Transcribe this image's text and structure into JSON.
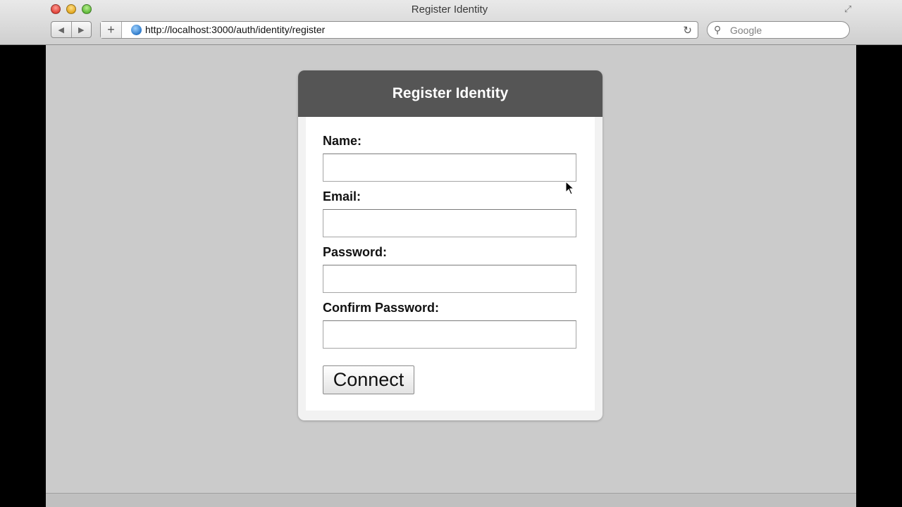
{
  "window": {
    "title": "Register Identity"
  },
  "toolbar": {
    "back_icon": "back-arrow-icon",
    "forward_icon": "forward-arrow-icon",
    "new_tab_label": "+",
    "url": "http://localhost:3000/auth/identity/register",
    "search_placeholder": "Google"
  },
  "form": {
    "title": "Register Identity",
    "fields": [
      {
        "label": "Name:"
      },
      {
        "label": "Email:"
      },
      {
        "label": "Password:"
      },
      {
        "label": "Confirm Password:"
      }
    ],
    "submit_label": "Connect"
  },
  "colors": {
    "page_background": "#cbcbcb",
    "panel_header": "#555555",
    "panel_frame": "#f2f2f2"
  }
}
